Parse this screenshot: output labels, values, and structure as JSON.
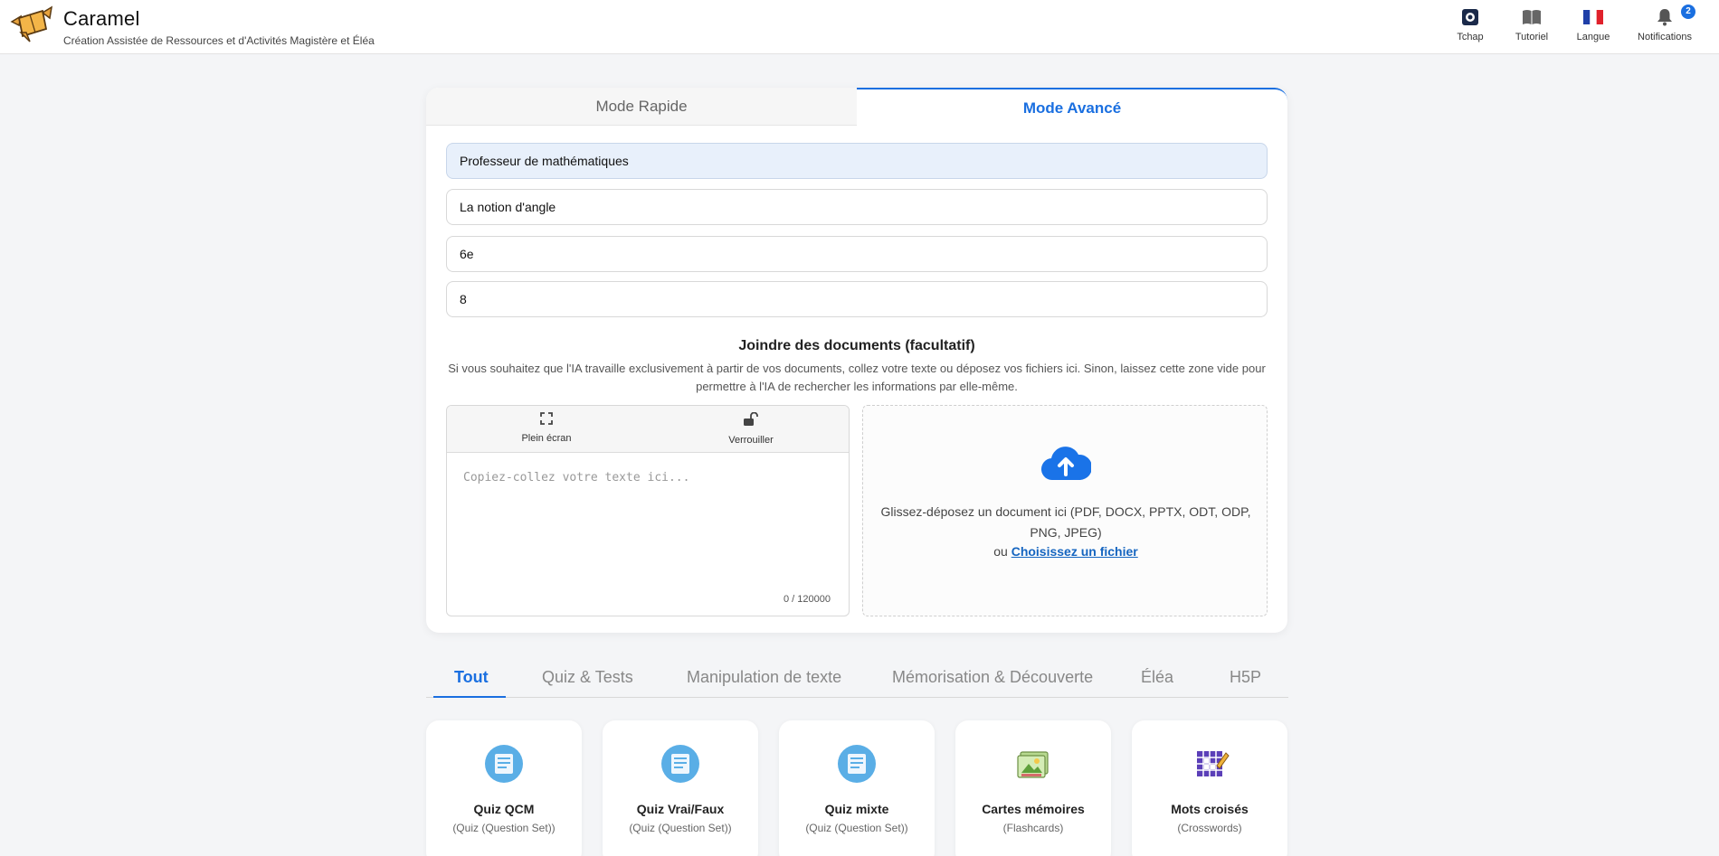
{
  "header": {
    "title": "Caramel",
    "subtitle": "Création Assistée de Ressources et d'Activités Magistère et Éléa",
    "nav": [
      {
        "label": "Tchap",
        "icon": "tchap-icon"
      },
      {
        "label": "Tutoriel",
        "icon": "book-icon"
      },
      {
        "label": "Langue",
        "icon": "french-flag-icon"
      },
      {
        "label": "Notifications",
        "icon": "bell-icon",
        "badge": "2"
      }
    ]
  },
  "modes": {
    "rapide": "Mode Rapide",
    "avance": "Mode Avancé",
    "active": "avance"
  },
  "fields": {
    "role": "Professeur de mathématiques",
    "topic": "La notion d'angle",
    "level": "6e",
    "count": "8"
  },
  "attach": {
    "title": "Joindre des documents (facultatif)",
    "description": "Si vous souhaitez que l'IA travaille exclusivement à partir de vos documents, collez votre texte ou déposez vos fichiers ici. Sinon, laissez cette zone vide pour permettre à l'IA de rechercher les informations par elle-même.",
    "fullscreen_label": "Plein écran",
    "lock_label": "Verrouiller",
    "text_placeholder": "Copiez-collez votre texte ici...",
    "counter": "0 / 120000",
    "drop_text": "Glissez-déposez un document ici (PDF, DOCX, PPTX, ODT, ODP, PNG, JPEG)",
    "drop_or": "ou",
    "drop_link": "Choisissez un fichier"
  },
  "categories": [
    {
      "label": "Tout",
      "active": true
    },
    {
      "label": "Quiz & Tests"
    },
    {
      "label": "Manipulation de texte"
    },
    {
      "label": "Mémorisation & Découverte"
    },
    {
      "label": "Éléa"
    },
    {
      "label": "H5P"
    }
  ],
  "activities": [
    {
      "title": "Quiz QCM",
      "subtitle": "(Quiz (Question Set))",
      "icon": "quiz-icon"
    },
    {
      "title": "Quiz Vrai/Faux",
      "subtitle": "(Quiz (Question Set))",
      "icon": "quiz-icon"
    },
    {
      "title": "Quiz mixte",
      "subtitle": "(Quiz (Question Set))",
      "icon": "quiz-icon"
    },
    {
      "title": "Cartes mémoires",
      "subtitle": "(Flashcards)",
      "icon": "flashcards-icon"
    },
    {
      "title": "Mots croisés",
      "subtitle": "(Crosswords)",
      "icon": "crossword-icon"
    }
  ],
  "colors": {
    "accent": "#1a6fe0",
    "link": "#1565c0",
    "background": "#f4f5f7"
  }
}
